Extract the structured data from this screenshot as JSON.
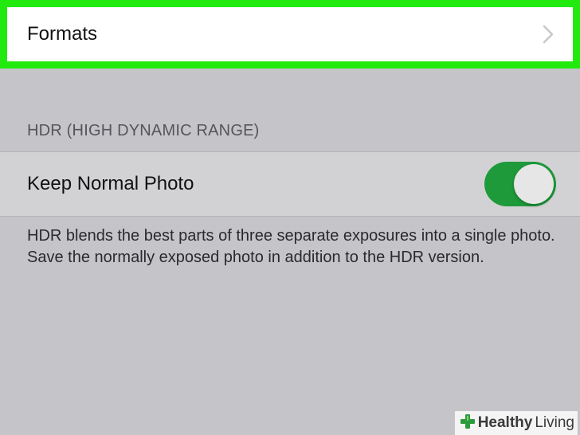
{
  "formats_row": {
    "label": "Formats",
    "highlight_color": "#22ea0e",
    "chevron_icon": "chevron-right-icon"
  },
  "hdr_section": {
    "header": "HDR (HIGH DYNAMIC RANGE)",
    "keep_normal_photo": {
      "label": "Keep Normal Photo",
      "state": "on",
      "on_color": "#1e9a3b"
    },
    "description": "HDR blends the best parts of three separate exposures into a single photo. Save the normally exposed photo in addition to the HDR version."
  },
  "watermark": {
    "text_bold": "Healthy",
    "text_regular": "Living",
    "icon": "cross-leaf-icon"
  }
}
